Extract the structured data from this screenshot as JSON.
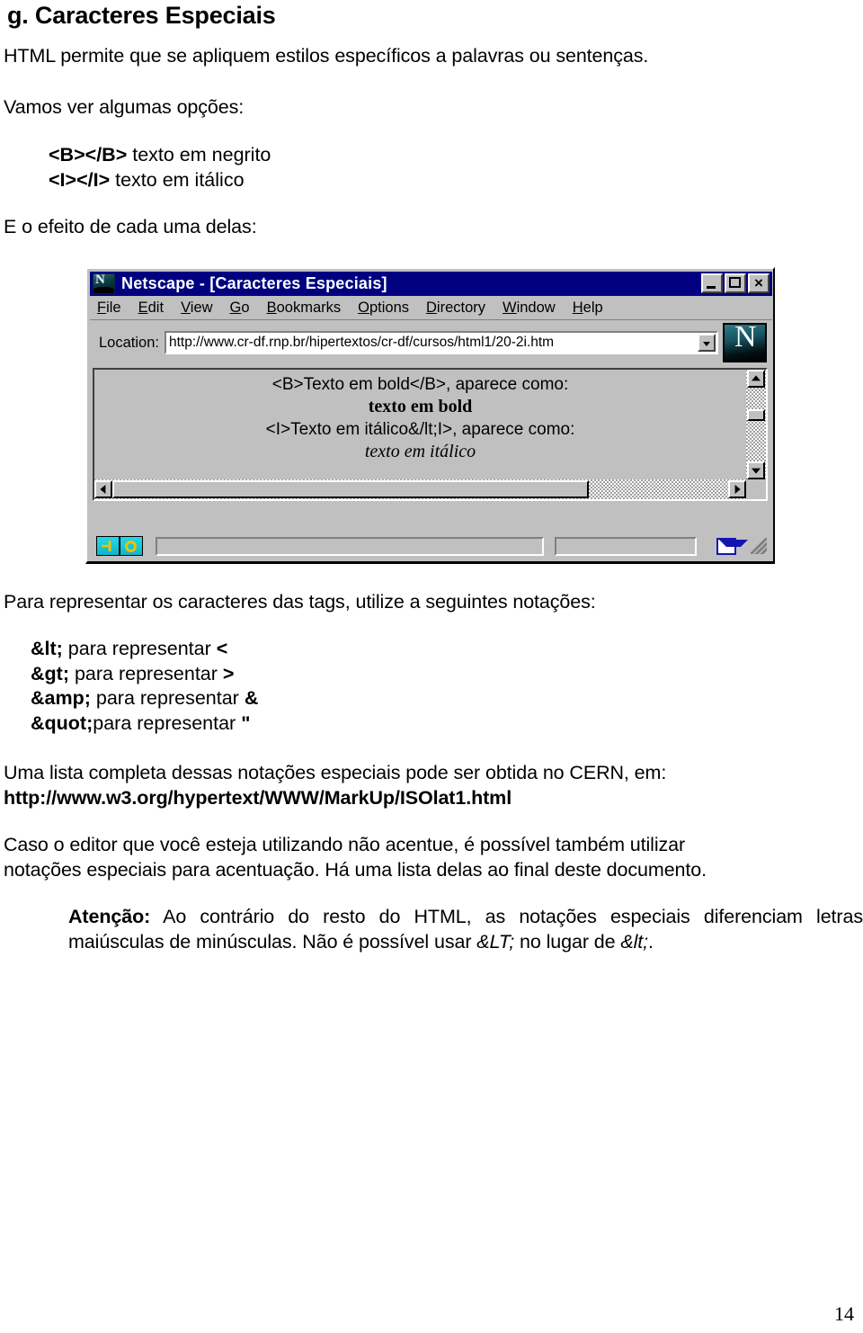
{
  "document": {
    "heading": "g. Caracteres Especiais",
    "intro": "HTML permite que se apliquem estilos específicos a palavras ou sentenças.",
    "vamos": "Vamos ver algumas opções:",
    "tags": [
      {
        "tag": "<B></B>",
        "desc": " texto em negrito"
      },
      {
        "tag": "<I></I>",
        "desc": " texto em itálico"
      }
    ],
    "efeito": "E o efeito de cada uma delas:",
    "para_representar": "Para representar os caracteres das tags, utilize a seguintes notações:",
    "notations": [
      {
        "entity": "&lt;",
        "text": " para representar ",
        "char": "<"
      },
      {
        "entity": "&gt;",
        "text": " para representar ",
        "char": ">"
      },
      {
        "entity": "&amp;",
        "text": " para representar ",
        "char": "&"
      },
      {
        "entity": "&quot;",
        "text": "para representar ",
        "char": "\""
      }
    ],
    "cern_line": "Uma lista completa dessas notações especiais pode ser obtida no CERN, em:",
    "cern_url": "http://www.w3.org/hypertext/WWW/MarkUp/ISOlat1.html",
    "caso": "Caso o editor que você esteja utilizando não acentue, é possível também utilizar notações especiais para acentuação. Há uma lista delas ao final deste documento.",
    "atencao": {
      "label": "Atenção:",
      "part1": " Ao contrário do resto do HTML, as notações especiais diferenciam letras maiúsculas de minúsculas. Não é possível usar ",
      "upper_entity": "&LT;",
      "part2": " no lugar de ",
      "lower_entity": "&lt;",
      "part3": "."
    },
    "page_number": "14"
  },
  "netscape": {
    "title": "Netscape - [Caracteres Especiais]",
    "logo_letter": "N",
    "window_buttons": {
      "minimize": "minimize",
      "maximize": "maximize",
      "close": "×"
    },
    "menus": [
      {
        "accel": "F",
        "rest": "ile"
      },
      {
        "accel": "E",
        "rest": "dit"
      },
      {
        "accel": "V",
        "rest": "iew"
      },
      {
        "accel": "G",
        "rest": "o"
      },
      {
        "accel": "B",
        "rest": "ookmarks"
      },
      {
        "accel": "O",
        "rest": "ptions"
      },
      {
        "accel": "D",
        "rest": "irectory"
      },
      {
        "accel": "W",
        "rest": "indow"
      },
      {
        "accel": "H",
        "rest": "elp"
      }
    ],
    "location": {
      "label": "Location:",
      "url": "http://www.cr-df.rnp.br/hipertextos/cr-df/cursos/html1/20-2i.htm"
    },
    "page_content": {
      "line1": "<B>Texto em bold</B>, aparece como:",
      "line2": "texto em bold",
      "line3": "<I>Texto em itálico&/lt;I>, aparece como:",
      "line4": "texto em itálico"
    },
    "status": {
      "field1": "",
      "field2": ""
    }
  },
  "colors": {
    "titlebar": "#000080",
    "window_face": "#c0c0c0",
    "mail_icon": "#1414b4",
    "status_icon": "#1fd8e8"
  }
}
